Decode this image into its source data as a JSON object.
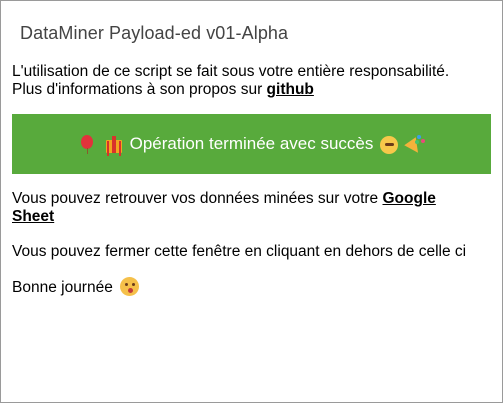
{
  "dialog": {
    "title": "DataMiner Payload-ed v01-Alpha"
  },
  "intro": {
    "line1": "L'utilisation de ce script se fait sous votre entière responsabilité.",
    "line2_prefix": "Plus d'informations à son propos sur ",
    "github_link": "github"
  },
  "banner": {
    "text": "Opération terminée avec succès",
    "background": "#58aa3c",
    "icons": [
      "balloon-icon",
      "gift-icon",
      "party-face-icon",
      "party-popper-icon"
    ]
  },
  "retrieve": {
    "prefix": "Vous pouvez retrouver vos données minées sur votre ",
    "link": "Google Sheet"
  },
  "close_hint": "Vous pouvez fermer cette fenêtre en cliquant en dehors de celle ci",
  "farewell": {
    "text": "Bonne journée",
    "icon": "kissing-face-icon"
  }
}
